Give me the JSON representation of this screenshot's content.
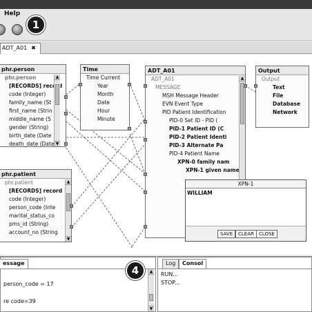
{
  "menu": {
    "help": "Help"
  },
  "badges": {
    "one": "1",
    "four": "4"
  },
  "tab": {
    "label": "ADT_A01",
    "close": "✖"
  },
  "nodes": {
    "person": {
      "title": "phr.person",
      "rows": [
        "phr.person",
        "[RECORDS] record",
        "code (Integer)",
        "family_name (St",
        "first_name (Strin",
        "middle_name (S",
        "gender (String)",
        "birth_date (Date",
        "death_date (Date"
      ]
    },
    "time": {
      "title": "Time",
      "rows": [
        "Time  Current",
        "Year",
        "Month",
        "Date",
        "Hour",
        "Minute"
      ]
    },
    "adt": {
      "title": "ADT_A01",
      "rows": [
        "ADT_A01",
        "MESSAGE",
        "MSH  Message Header",
        "EVN  Event Type",
        "PID  Patient Identification",
        "PID-0  Set ID - PID (",
        "PID-1  Patient ID (C",
        "PID-2  Patient Identi",
        "PID-3  Alternate Pa",
        "PID-4  Patient Name",
        "XPN-0  family nam",
        "XPN-1  given name"
      ]
    },
    "output": {
      "title": "Output",
      "rows": [
        "Output",
        "Text",
        "File",
        "Database",
        "Network"
      ]
    },
    "patient": {
      "title": "phr.patient",
      "rows": [
        "phr.patient",
        "[RECORDS] record",
        "code (Integer)",
        "person_code (Inte",
        "marital_status_co",
        "pms_id (String)",
        "account_no (String"
      ]
    }
  },
  "popup": {
    "title": "XPN-1",
    "value": "WILLIAM",
    "save": "SAVE",
    "clear": "CLEAR",
    "close": "CLOSE"
  },
  "message_panel": {
    "tab": "essage",
    "lines": [
      "person_code = 17",
      "re code=39"
    ]
  },
  "log_panel": {
    "tab_log": "Log",
    "tab_console": "Consol",
    "lines": [
      "RUN...",
      "STOP..."
    ]
  }
}
